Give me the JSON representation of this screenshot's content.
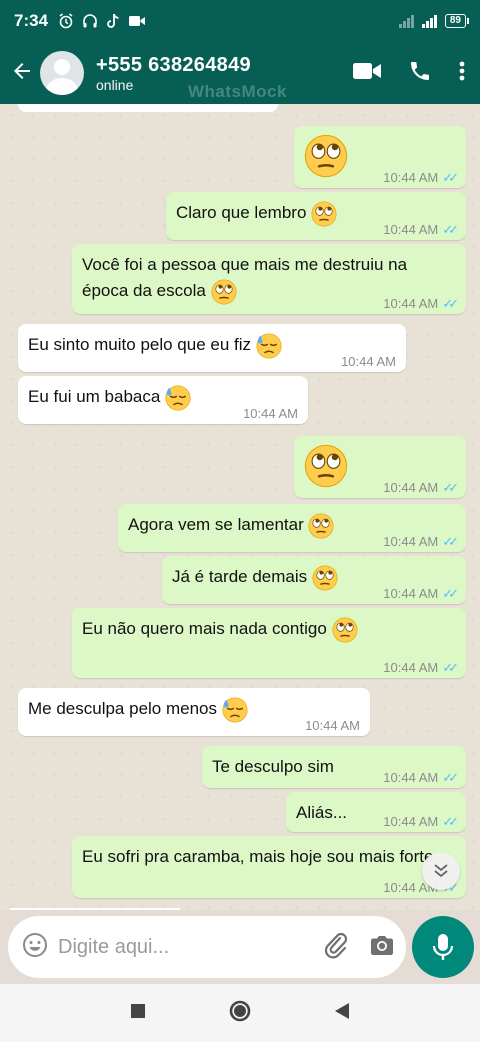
{
  "status_bar": {
    "time": "7:34",
    "battery": "89"
  },
  "header": {
    "contact_name": "+555 638264849",
    "contact_status": "online",
    "watermark": "WhatsMock"
  },
  "messages": [
    {
      "dir": "out",
      "text": "",
      "emoji": "eyeroll",
      "big": true,
      "time": "10:44 AM"
    },
    {
      "dir": "out",
      "text": "Claro que lembro",
      "emoji": "eyeroll",
      "time": "10:44 AM"
    },
    {
      "dir": "out",
      "text": "Você foi a pessoa que mais me destruiu na época da escola",
      "emoji": "eyeroll",
      "time": "10:44 AM"
    },
    {
      "dir": "in",
      "text": "Eu sinto muito pelo que eu fiz",
      "emoji": "sweat",
      "time": "10:44 AM"
    },
    {
      "dir": "in",
      "text": "Eu fui um babaca",
      "emoji": "sweat",
      "time": "10:44 AM"
    },
    {
      "dir": "out",
      "text": "",
      "emoji": "eyeroll",
      "big": true,
      "time": "10:44 AM"
    },
    {
      "dir": "out",
      "text": "Agora vem se lamentar",
      "emoji": "eyeroll",
      "time": "10:44 AM"
    },
    {
      "dir": "out",
      "text": "Já é tarde demais",
      "emoji": "eyeroll",
      "time": "10:44 AM"
    },
    {
      "dir": "out",
      "text": "Eu não quero mais nada contigo",
      "emoji": "eyeroll",
      "time": "10:44 AM"
    },
    {
      "dir": "in",
      "text": "Me desculpa pelo menos",
      "emoji": "sweat",
      "time": "10:44 AM"
    },
    {
      "dir": "out",
      "text": "Te desculpo sim",
      "emoji": "",
      "time": "10:44 AM"
    },
    {
      "dir": "out",
      "text": "Aliás...",
      "emoji": "",
      "time": "10:44 AM"
    },
    {
      "dir": "out",
      "text": "Eu sofri pra caramba, mais hoje sou mais forte",
      "emoji": "",
      "time": "10:44 AM"
    }
  ],
  "composer": {
    "placeholder": "Digite aqui..."
  },
  "icons": {
    "back": "arrow-left-icon",
    "video": "video-call-icon",
    "call": "phone-icon",
    "menu": "more-vert-icon",
    "emoji": "emoji-icon",
    "attach": "paperclip-icon",
    "camera": "camera-icon",
    "mic": "mic-icon",
    "scroll": "chevron-double-down-icon"
  },
  "colors": {
    "header": "#075e54",
    "outgoing": "#dcf8c6",
    "incoming": "#ffffff",
    "ticks": "#4fc3f7",
    "fab": "#00897b"
  }
}
